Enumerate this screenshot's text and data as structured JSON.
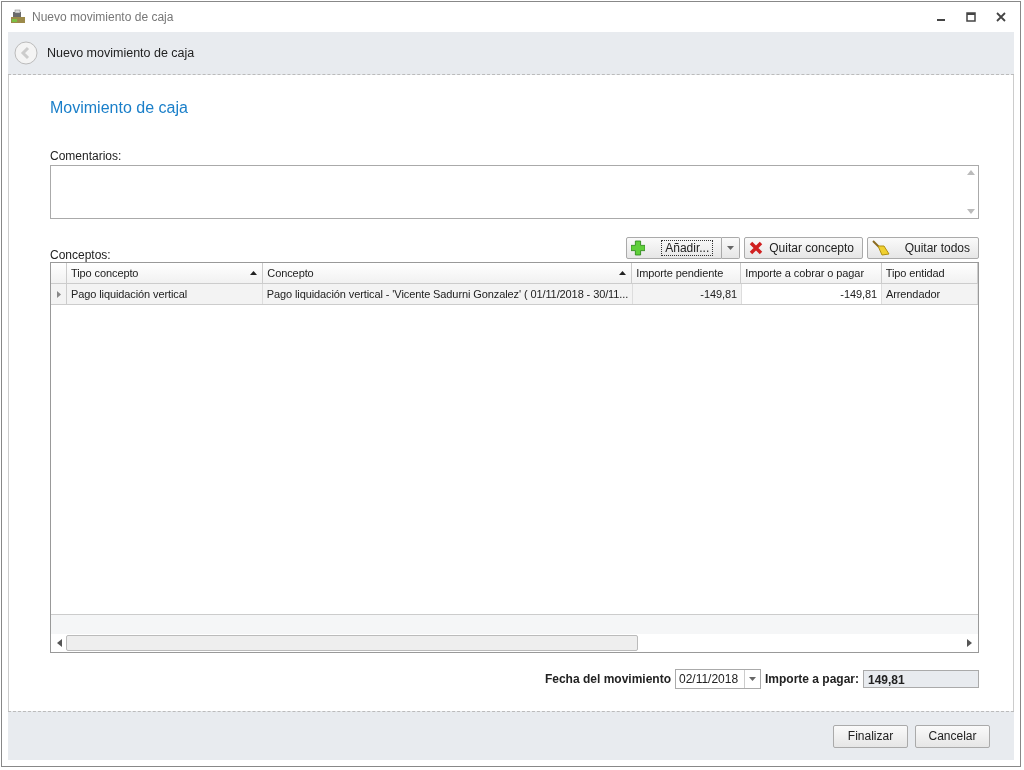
{
  "window": {
    "title": "Nuevo movimiento de caja"
  },
  "header": {
    "title": "Nuevo movimiento de caja"
  },
  "section_title": "Movimiento de caja",
  "comments": {
    "label": "Comentarios:"
  },
  "concepts": {
    "label": "Conceptos:",
    "buttons": [
      {
        "kind": "add",
        "label": "Añadir..."
      },
      {
        "kind": "remove",
        "label": "Quitar concepto"
      },
      {
        "kind": "clear",
        "label": "Quitar todos"
      }
    ],
    "columns": [
      {
        "label": "Tipo concepto",
        "sorted": true
      },
      {
        "label": "Concepto",
        "sorted": true
      },
      {
        "label": "Importe pendiente",
        "sorted": false
      },
      {
        "label": "Importe a cobrar o pagar",
        "sorted": false
      },
      {
        "label": "Tipo entidad",
        "sorted": false
      }
    ],
    "rows": [
      {
        "selected": true,
        "cells": [
          "Pago liquidación vertical",
          "Pago liquidación vertical - 'Vicente Sadurni Gonzalez' ( 01/11/2018 - 30/11...",
          "-149,81",
          "-149,81",
          "Arrendador"
        ]
      }
    ]
  },
  "date": {
    "label": "Fecha del movimiento",
    "value": "02/11/2018"
  },
  "amount": {
    "label": "Importe a pagar:",
    "value": "149,81"
  },
  "footer_buttons": [
    "Finalizar",
    "Cancelar"
  ]
}
